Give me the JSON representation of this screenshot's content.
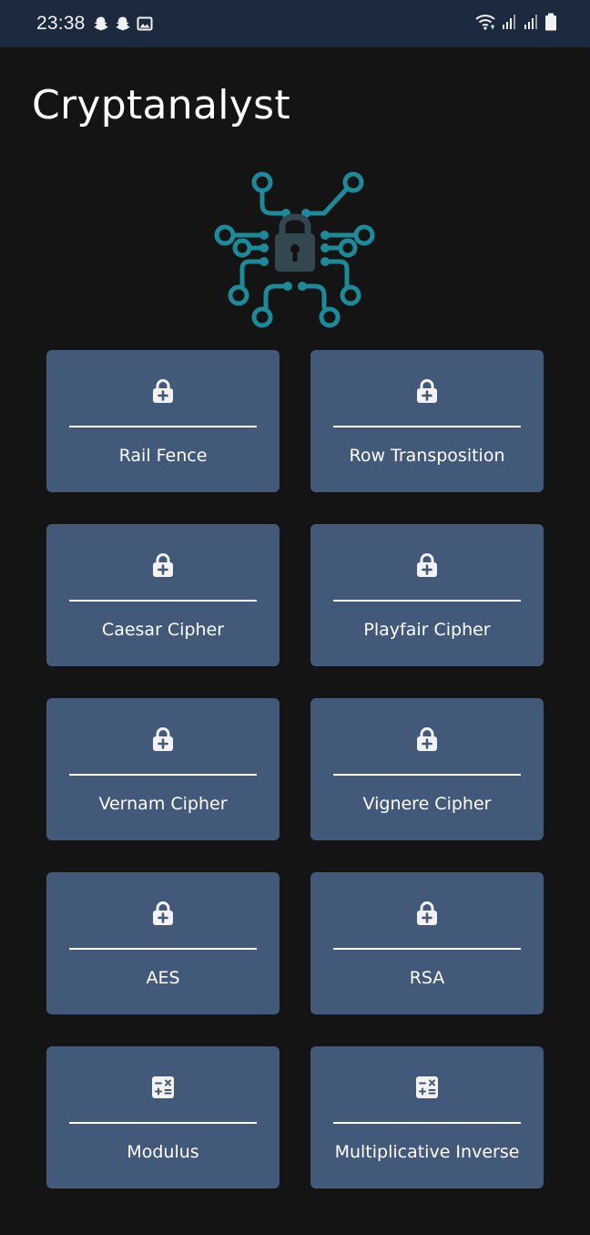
{
  "status_bar": {
    "time": "23:38",
    "left_icons": [
      "snapchat-icon",
      "snapchat-icon",
      "gallery-icon"
    ],
    "right_icons": [
      "wifi-icon",
      "signal-icon",
      "signal-icon",
      "battery-icon"
    ]
  },
  "app": {
    "title": "Cryptanalyst"
  },
  "colors": {
    "background": "#141414",
    "status_bar": "#1c2a3f",
    "card": "#42597a",
    "accent_teal": "#1d8a9a"
  },
  "cards": [
    {
      "label": "Rail Fence",
      "icon": "lock-plus-icon"
    },
    {
      "label": "Row Transposition",
      "icon": "lock-plus-icon"
    },
    {
      "label": "Caesar Cipher",
      "icon": "lock-plus-icon"
    },
    {
      "label": "Playfair Cipher",
      "icon": "lock-plus-icon"
    },
    {
      "label": "Vernam Cipher",
      "icon": "lock-plus-icon"
    },
    {
      "label": "Vignere Cipher",
      "icon": "lock-plus-icon"
    },
    {
      "label": "AES",
      "icon": "lock-plus-icon"
    },
    {
      "label": "RSA",
      "icon": "lock-plus-icon"
    },
    {
      "label": "Modulus",
      "icon": "calculator-icon"
    },
    {
      "label": "Multiplicative Inverse",
      "icon": "calculator-icon"
    }
  ]
}
